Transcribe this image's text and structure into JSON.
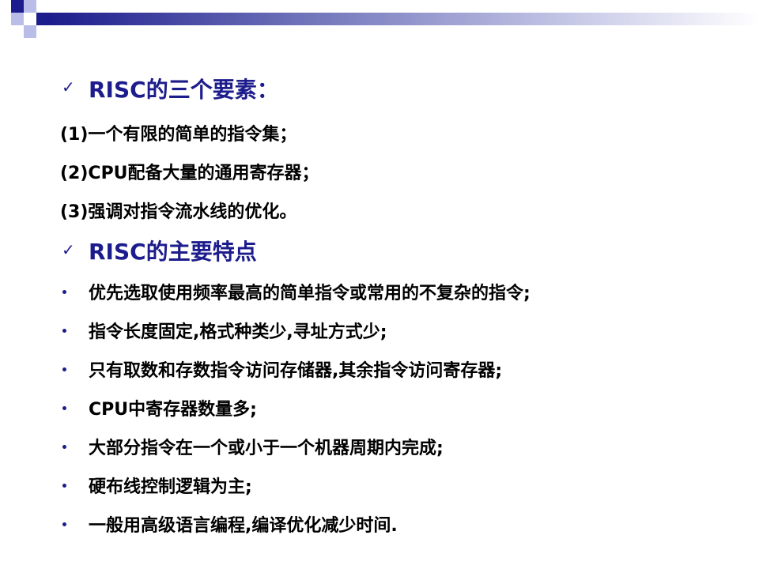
{
  "colors": {
    "heading": "#1c1c8c",
    "body_text": "#000000",
    "accent_light": "#b9bde8"
  },
  "icons": {
    "heading_marker": "checkmark-icon",
    "bullet_marker": "bullet-dot-icon"
  },
  "section1": {
    "heading": "RISC的三个要素：",
    "items": [
      "(1)一个有限的简单的指令集；",
      "(2)CPU配备大量的通用寄存器；",
      "(3)强调对指令流水线的优化。"
    ]
  },
  "section2": {
    "heading": "RISC的主要特点",
    "bullets": [
      "优先选取使用频率最高的简单指令或常用的不复杂的指令;",
      "指令长度固定,格式种类少,寻址方式少;",
      "只有取数和存数指令访问存储器,其余指令访问寄存器;",
      "CPU中寄存器数量多;",
      "大部分指令在一个或小于一个机器周期内完成;",
      "硬布线控制逻辑为主;",
      "一般用高级语言编程,编译优化减少时间."
    ]
  }
}
